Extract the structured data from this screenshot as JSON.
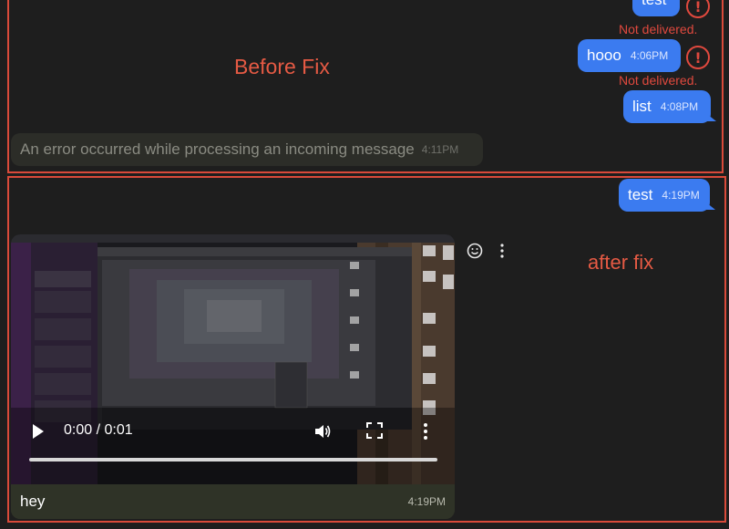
{
  "annotations": {
    "before": "Before Fix",
    "after": "after fix"
  },
  "before": {
    "messages": [
      {
        "text": "test",
        "status": "Not delivered."
      },
      {
        "text": "hooo",
        "time": "4:06PM",
        "status": "Not delivered."
      },
      {
        "text": "list",
        "time": "4:08PM"
      }
    ],
    "incoming_error": {
      "text": "An error occurred while processing an incoming message",
      "time": "4:11PM"
    }
  },
  "after": {
    "outgoing": {
      "text": "test",
      "time": "4:19PM"
    },
    "media": {
      "current_time": "0:00",
      "duration": "0:01",
      "time_display": "0:00 / 0:01",
      "caption": "hey",
      "time": "4:19PM"
    },
    "actions": [
      "smiley-icon",
      "more-vertical-icon"
    ]
  },
  "icons": {
    "error": "!",
    "play": "play-icon",
    "volume": "volume-icon",
    "fullscreen": "fullscreen-icon",
    "more": "more-vertical-icon"
  },
  "colors": {
    "background": "#1e1e1e",
    "outgoing_bubble": "#3b7bf0",
    "error_red": "#e0493e",
    "annotation_red": "#e55a44",
    "incoming_bubble": "#2c2d28"
  }
}
